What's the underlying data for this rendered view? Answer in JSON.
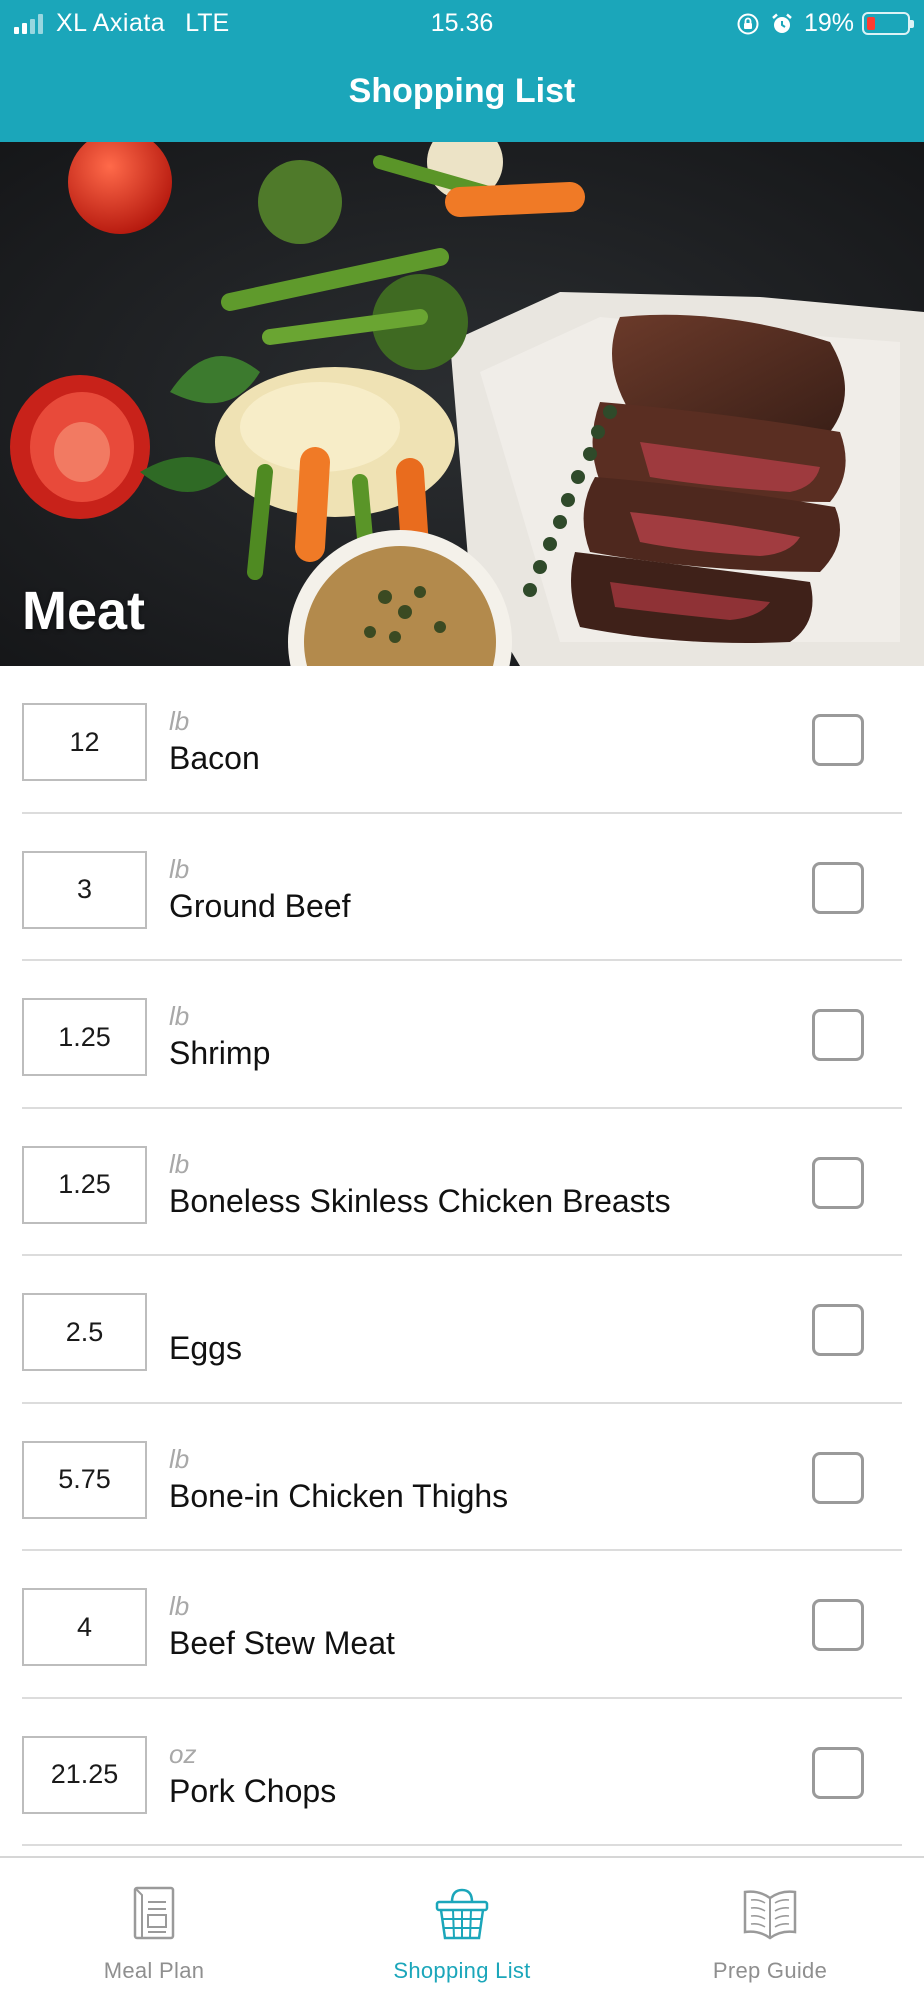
{
  "status_bar": {
    "carrier": "XL Axiata",
    "network": "LTE",
    "time": "15.36",
    "battery_percent": "19%",
    "battery_level": 0.19,
    "icons": [
      "orientation-lock-icon",
      "alarm-icon"
    ]
  },
  "header": {
    "title": "Shopping List",
    "accent_color": "#1ba6ba"
  },
  "banner": {
    "category": "Meat",
    "image": "steak-with-vegetables-photo"
  },
  "items": [
    {
      "qty": "12",
      "unit": "lb",
      "name": "Bacon",
      "checked": false
    },
    {
      "qty": "3",
      "unit": "lb",
      "name": "Ground Beef",
      "checked": false
    },
    {
      "qty": "1.25",
      "unit": "lb",
      "name": "Shrimp",
      "checked": false
    },
    {
      "qty": "1.25",
      "unit": "lb",
      "name": "Boneless Skinless Chicken Breasts",
      "checked": false
    },
    {
      "qty": "2.5",
      "unit": "",
      "name": "Eggs",
      "checked": false
    },
    {
      "qty": "5.75",
      "unit": "lb",
      "name": "Bone-in Chicken Thighs",
      "checked": false
    },
    {
      "qty": "4",
      "unit": "lb",
      "name": "Beef Stew Meat",
      "checked": false
    },
    {
      "qty": "21.25",
      "unit": "oz",
      "name": "Pork Chops",
      "checked": false
    }
  ],
  "tabbar": {
    "tabs": [
      {
        "label": "Meal Plan",
        "icon": "meal-plan-icon",
        "active": false
      },
      {
        "label": "Shopping List",
        "icon": "shopping-basket-icon",
        "active": true
      },
      {
        "label": "Prep Guide",
        "icon": "book-icon",
        "active": false
      }
    ]
  }
}
